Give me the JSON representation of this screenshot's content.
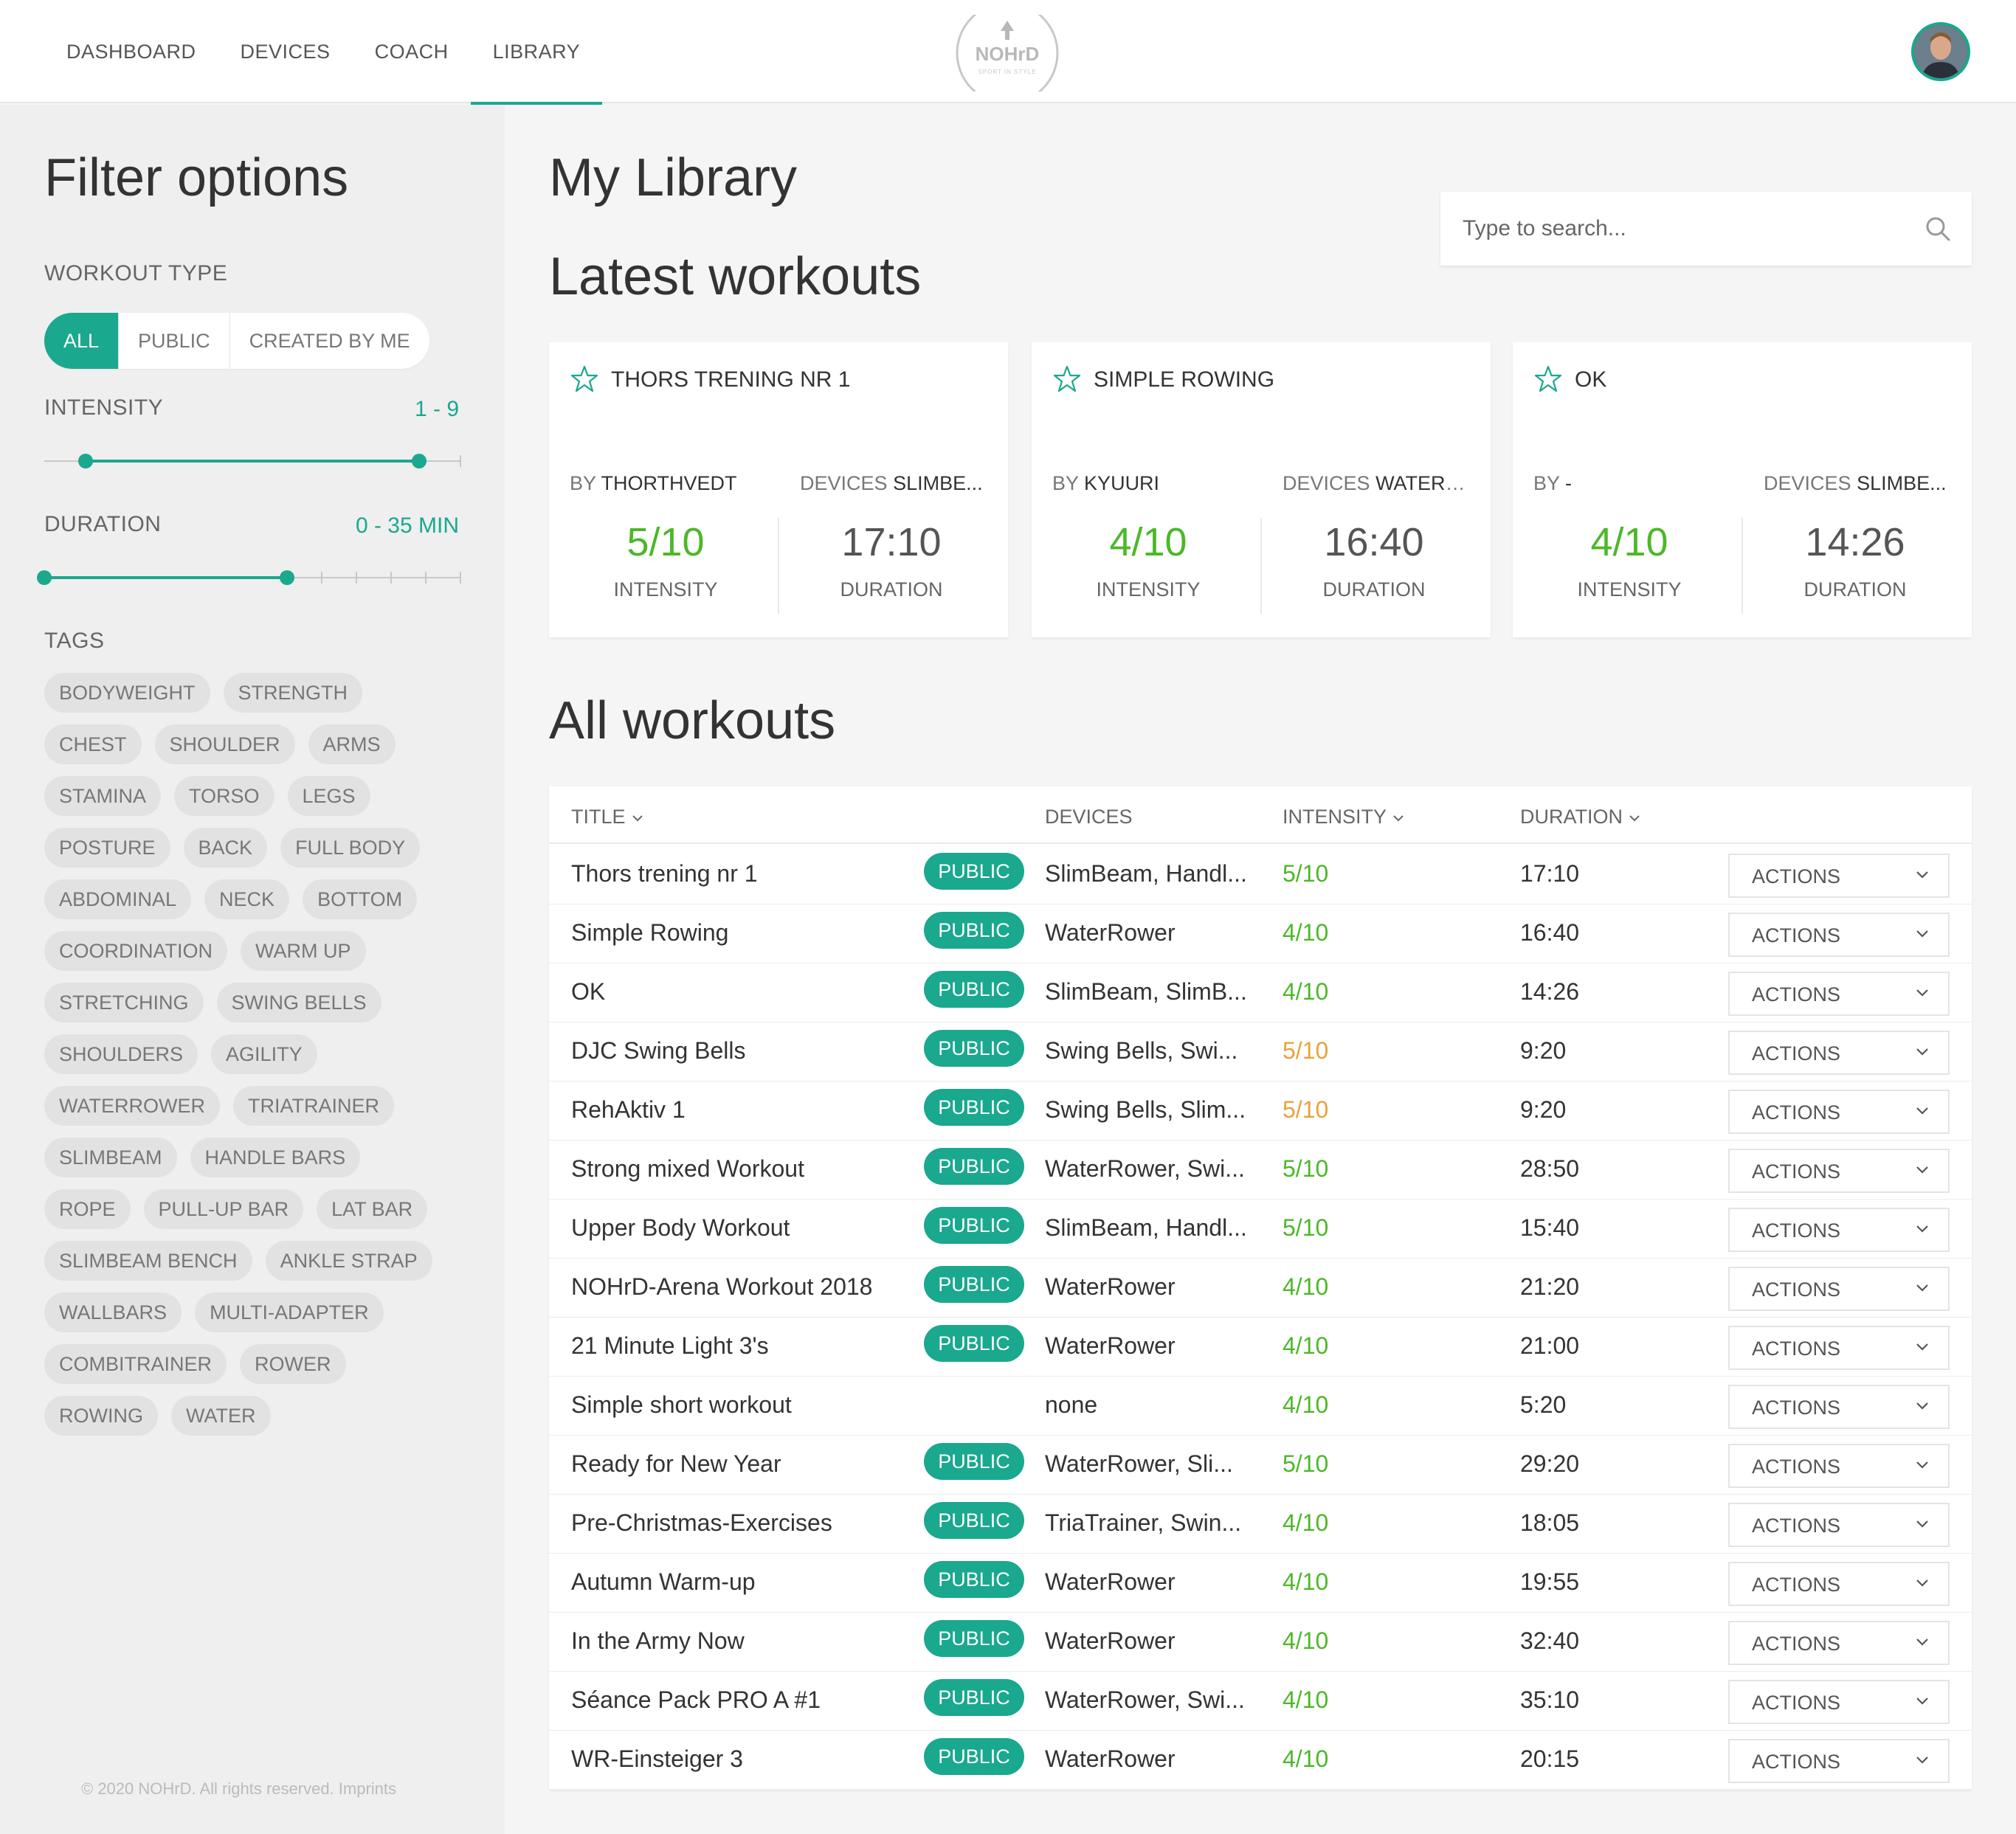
{
  "nav": {
    "items": [
      {
        "label": "DASHBOARD",
        "active": false
      },
      {
        "label": "DEVICES",
        "active": false
      },
      {
        "label": "COACH",
        "active": false
      },
      {
        "label": "LIBRARY",
        "active": true
      }
    ],
    "logo_text": "NOHrD",
    "logo_tagline": "SPORT IN STYLE"
  },
  "sidebar": {
    "title": "Filter options",
    "workout_type_label": "WORKOUT TYPE",
    "workout_types": [
      "ALL",
      "PUBLIC",
      "CREATED BY ME"
    ],
    "selected_workout_type": "ALL",
    "intensity": {
      "label": "INTENSITY",
      "value_text": "1 - 9",
      "min": 1,
      "max": 9,
      "scale_max": 10
    },
    "duration": {
      "label": "DURATION",
      "value_text": "0 - 35 MIN",
      "min": 0,
      "max": 35,
      "scale_max": 60
    },
    "tags_label": "TAGS",
    "tags": [
      [
        "BODYWEIGHT",
        "STRENGTH"
      ],
      [
        "CHEST",
        "SHOULDER",
        "ARMS"
      ],
      [
        "STAMINA",
        "TORSO",
        "LEGS"
      ],
      [
        "POSTURE",
        "BACK",
        "FULL BODY"
      ],
      [
        "ABDOMINAL",
        "NECK",
        "BOTTOM"
      ],
      [
        "COORDINATION",
        "WARM UP"
      ],
      [
        "STRETCHING",
        "SWING BELLS"
      ],
      [
        "SHOULDERS",
        "AGILITY"
      ],
      [
        "WATERROWER",
        "TRIATRAINER"
      ],
      [
        "SLIMBEAM",
        "HANDLE BARS"
      ],
      [
        "ROPE",
        "PULL-UP BAR",
        "LAT BAR"
      ],
      [
        "SLIMBEAM BENCH",
        "ANKLE STRAP"
      ],
      [
        "WALLBARS",
        "MULTI-ADAPTER"
      ],
      [
        "COMBITRAINER",
        "ROWER"
      ],
      [
        "ROWING",
        "WATER"
      ]
    ],
    "footer": "© 2020 NOHrD. All rights reserved. Imprints"
  },
  "main": {
    "title": "My Library",
    "search_placeholder": "Type to search...",
    "latest_title": "Latest workouts",
    "all_title": "All workouts",
    "by_label": "BY",
    "devices_label": "DEVICES",
    "intensity_label": "INTENSITY",
    "duration_label": "DURATION",
    "latest": [
      {
        "title": "THORS TRENING NR 1",
        "by": "THORTHVEDT",
        "devices": "SLIMBE...",
        "intensity": "5/10",
        "duration": "17:10"
      },
      {
        "title": "SIMPLE ROWING",
        "by": "KYUURI",
        "devices": "WATERR...",
        "intensity": "4/10",
        "duration": "16:40"
      },
      {
        "title": "OK",
        "by": "-",
        "devices": "SLIMBE...",
        "intensity": "4/10",
        "duration": "14:26"
      }
    ],
    "table": {
      "headers": {
        "title": "TITLE",
        "devices": "DEVICES",
        "intensity": "INTENSITY",
        "duration": "DURATION"
      },
      "public_label": "PUBLIC",
      "actions_label": "ACTIONS",
      "rows": [
        {
          "title": "Thors trening nr 1",
          "public": true,
          "devices": "SlimBeam, Handl...",
          "intensity": "5/10",
          "level": "green",
          "duration": "17:10"
        },
        {
          "title": "Simple Rowing",
          "public": true,
          "devices": "WaterRower",
          "intensity": "4/10",
          "level": "green",
          "duration": "16:40"
        },
        {
          "title": "OK",
          "public": true,
          "devices": "SlimBeam, SlimB...",
          "intensity": "4/10",
          "level": "green",
          "duration": "14:26"
        },
        {
          "title": "DJC Swing Bells",
          "public": true,
          "devices": "Swing Bells, Swi...",
          "intensity": "5/10",
          "level": "orange",
          "duration": "9:20"
        },
        {
          "title": "RehAktiv 1",
          "public": true,
          "devices": "Swing Bells, Slim...",
          "intensity": "5/10",
          "level": "orange",
          "duration": "9:20"
        },
        {
          "title": "Strong mixed Workout",
          "public": true,
          "devices": "WaterRower, Swi...",
          "intensity": "5/10",
          "level": "green",
          "duration": "28:50"
        },
        {
          "title": "Upper Body Workout",
          "public": true,
          "devices": "SlimBeam, Handl...",
          "intensity": "5/10",
          "level": "green",
          "duration": "15:40"
        },
        {
          "title": "NOHrD-Arena Workout 2018",
          "public": true,
          "devices": "WaterRower",
          "intensity": "4/10",
          "level": "green",
          "duration": "21:20"
        },
        {
          "title": "21 Minute Light 3's",
          "public": true,
          "devices": "WaterRower",
          "intensity": "4/10",
          "level": "green",
          "duration": "21:00"
        },
        {
          "title": "Simple short workout",
          "public": false,
          "devices": "none",
          "intensity": "4/10",
          "level": "green",
          "duration": "5:20"
        },
        {
          "title": "Ready for New Year",
          "public": true,
          "devices": "WaterRower, Sli...",
          "intensity": "5/10",
          "level": "green",
          "duration": "29:20"
        },
        {
          "title": "Pre-Christmas-Exercises",
          "public": true,
          "devices": "TriaTrainer, Swin...",
          "intensity": "4/10",
          "level": "green",
          "duration": "18:05"
        },
        {
          "title": "Autumn Warm-up",
          "public": true,
          "devices": "WaterRower",
          "intensity": "4/10",
          "level": "green",
          "duration": "19:55"
        },
        {
          "title": "In the Army Now",
          "public": true,
          "devices": "WaterRower",
          "intensity": "4/10",
          "level": "green",
          "duration": "32:40"
        },
        {
          "title": "Séance Pack PRO A #1",
          "public": true,
          "devices": "WaterRower, Swi...",
          "intensity": "4/10",
          "level": "green",
          "duration": "35:10"
        },
        {
          "title": "WR-Einsteiger 3",
          "public": true,
          "devices": "WaterRower",
          "intensity": "4/10",
          "level": "green",
          "duration": "20:15"
        }
      ]
    }
  },
  "colors": {
    "accent": "#1aa88e",
    "green": "#4cb828",
    "orange": "#e8a33a"
  }
}
